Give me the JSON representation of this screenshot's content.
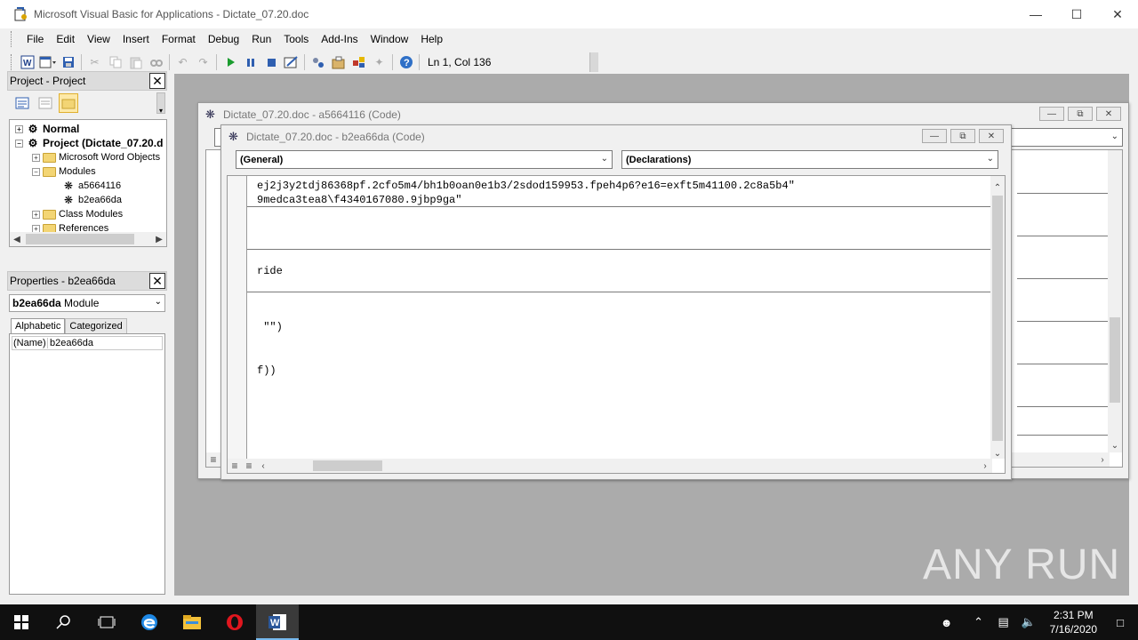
{
  "window": {
    "title": "Microsoft Visual Basic for Applications - Dictate_07.20.doc"
  },
  "menu": [
    "File",
    "Edit",
    "View",
    "Insert",
    "Format",
    "Debug",
    "Run",
    "Tools",
    "Add-Ins",
    "Window",
    "Help"
  ],
  "toolbar": {
    "status": "Ln 1, Col 136",
    "icons": [
      "view-word-icon",
      "insert-module-icon",
      "save-icon",
      "cut-icon",
      "copy-icon",
      "paste-icon",
      "find-icon",
      "undo-icon",
      "redo-icon",
      "run-icon",
      "break-icon",
      "reset-icon",
      "design-mode-icon",
      "project-explorer-icon",
      "properties-icon",
      "object-browser-icon",
      "toolbox-icon",
      "help-icon"
    ]
  },
  "project_pane": {
    "title": "Project - Project",
    "tree": [
      {
        "label": "Normal",
        "bold": true,
        "expander": "+"
      },
      {
        "label": "Project (Dictate_07.20.d",
        "bold": true,
        "expander": "−"
      },
      {
        "label": "Microsoft Word Objects",
        "expander": "+"
      },
      {
        "label": "Modules",
        "expander": "−"
      },
      {
        "label": "a5664116"
      },
      {
        "label": "b2ea66da"
      },
      {
        "label": "Class Modules",
        "expander": "+"
      },
      {
        "label": "References",
        "expander": "+"
      }
    ]
  },
  "properties_pane": {
    "title": "Properties - b2ea66da",
    "object_name": "b2ea66da",
    "object_type": "Module",
    "tabs": [
      "Alphabetic",
      "Categorized"
    ],
    "rows": [
      {
        "name": "(Name)",
        "value": "b2ea66da"
      }
    ]
  },
  "back_code_window": {
    "title": "Dictate_07.20.doc - a5664116 (Code)"
  },
  "front_code_window": {
    "title": "Dictate_07.20.doc - b2ea66da (Code)",
    "object_combo": "(General)",
    "proc_combo": "(Declarations)",
    "lines": [
      "ej2j3y2tdj86368pf.2cfo5m4/bh1b0oan0e1b3/2sdod159953.fpeh4p6?e16=exft5m41100.2c8a5b4\"",
      "9medca3tea8\\f4340167080.9jbp9ga\"",
      "ride",
      " \"\")",
      "f))"
    ]
  },
  "watermark": "ANY RUN",
  "taskbar": {
    "time": "2:31 PM",
    "date": "7/16/2020"
  }
}
